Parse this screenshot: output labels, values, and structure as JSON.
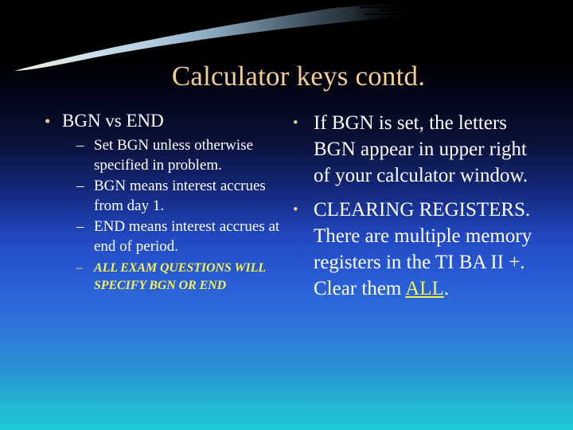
{
  "slide": {
    "title": "Calculator keys contd.",
    "title_color": "#f3cd94",
    "bullet_color": "#f0c98d",
    "text_color": "#ffffff",
    "accent_color": "#f2f255",
    "background_top_color": "#000000",
    "background_mid_color": "#2a5fd8",
    "background_bottom_color": "#1dc9d6",
    "bullet_glyph": "•",
    "dash_glyph": "–"
  },
  "left_column": {
    "heading": "BGN vs END",
    "sub_items": [
      "Set BGN unless otherwise specified in problem.",
      "BGN means interest accrues from day 1.",
      "END means interest accrues at end of period."
    ],
    "emphasis_item": "ALL EXAM QUESTIONS WILL SPECIFY BGN OR END"
  },
  "right_column": {
    "items": [
      "If BGN is set, the letters BGN appear in upper right of your calculator window.",
      "CLEARING REGISTERS.  There are multiple memory registers in the TI BA II +.  Clear them "
    ],
    "item2_highlight": "ALL",
    "item2_tail": "."
  }
}
